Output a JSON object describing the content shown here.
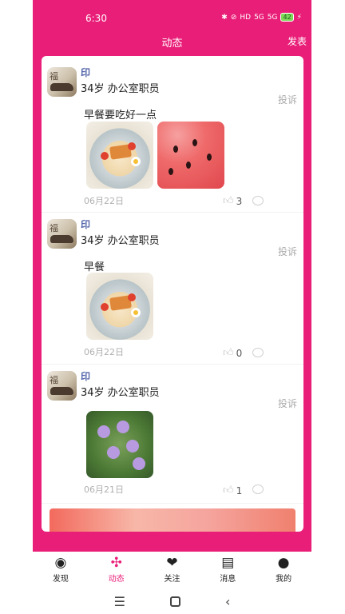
{
  "status": {
    "time": "6:30",
    "icons": [
      "bluetooth-icon",
      "mute-icon",
      "hd-icon",
      "signal-5g-icon",
      "signal-5g-icon"
    ],
    "hd": "HD",
    "sig1": "5G",
    "sig2": "5G",
    "battery": "42"
  },
  "appbar": {
    "title": "动态",
    "post_label": "发表"
  },
  "posts": [
    {
      "user": "印",
      "info": "34岁 办公室职员",
      "report": "投诉",
      "text": "早餐要吃好一点",
      "images": [
        "food-photo",
        "watermelon-photo"
      ],
      "date": "06月22日",
      "likes": "3"
    },
    {
      "user": "印",
      "info": "34岁 办公室职员",
      "report": "投诉",
      "text": "早餐",
      "images": [
        "food-photo"
      ],
      "date": "06月22日",
      "likes": "0"
    },
    {
      "user": "印",
      "info": "34岁 办公室职员",
      "report": "投诉",
      "text": "",
      "images": [
        "flower-photo"
      ],
      "date": "06月21日",
      "likes": "1"
    }
  ],
  "nav": [
    {
      "label": "发现",
      "icon": "eye-icon"
    },
    {
      "label": "动态",
      "icon": "pinwheel-icon"
    },
    {
      "label": "关注",
      "icon": "hearts-icon"
    },
    {
      "label": "消息",
      "icon": "chat-icon"
    },
    {
      "label": "我的",
      "icon": "person-icon"
    }
  ],
  "colors": {
    "brand": "#e91e78",
    "card": "#ffffff",
    "name": "#5566aa"
  }
}
